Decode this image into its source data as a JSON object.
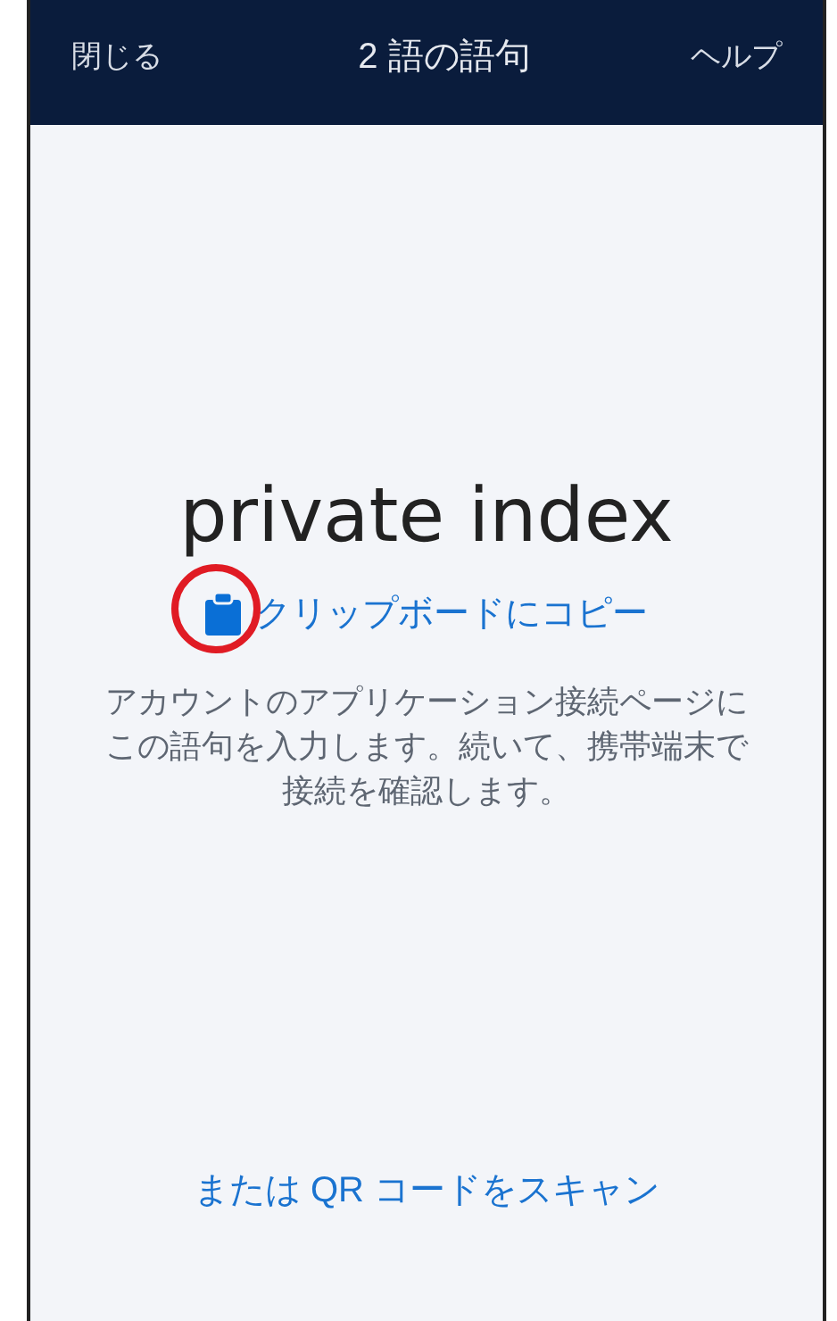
{
  "header": {
    "close": "閉じる",
    "title": "2 語の語句",
    "help": "ヘルプ"
  },
  "phrase": "private index",
  "copy_link": {
    "label": "クリップボードにコピー",
    "highlighted": true
  },
  "instructions": "アカウントのアプリケーション接続ページにこの語句を入力します。続いて、携帯端末で接続を確認します。",
  "qr_link": "または QR コードをスキャン"
}
